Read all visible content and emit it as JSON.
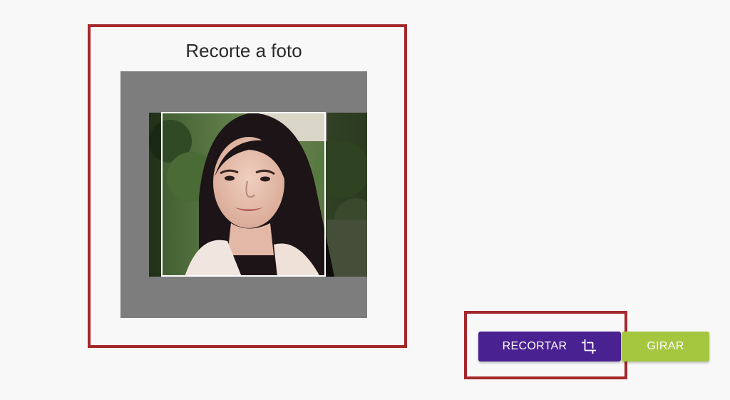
{
  "cropper": {
    "title": "Recorte a foto"
  },
  "buttons": {
    "crop_label": "RECORTAR",
    "crop_icon": "crop-icon",
    "rotate_label": "GIRAR"
  },
  "colors": {
    "highlight": "#a4282c",
    "crop_button": "#4a2191",
    "rotate_button": "#a5c740",
    "stage_background": "#7d7d7d"
  }
}
